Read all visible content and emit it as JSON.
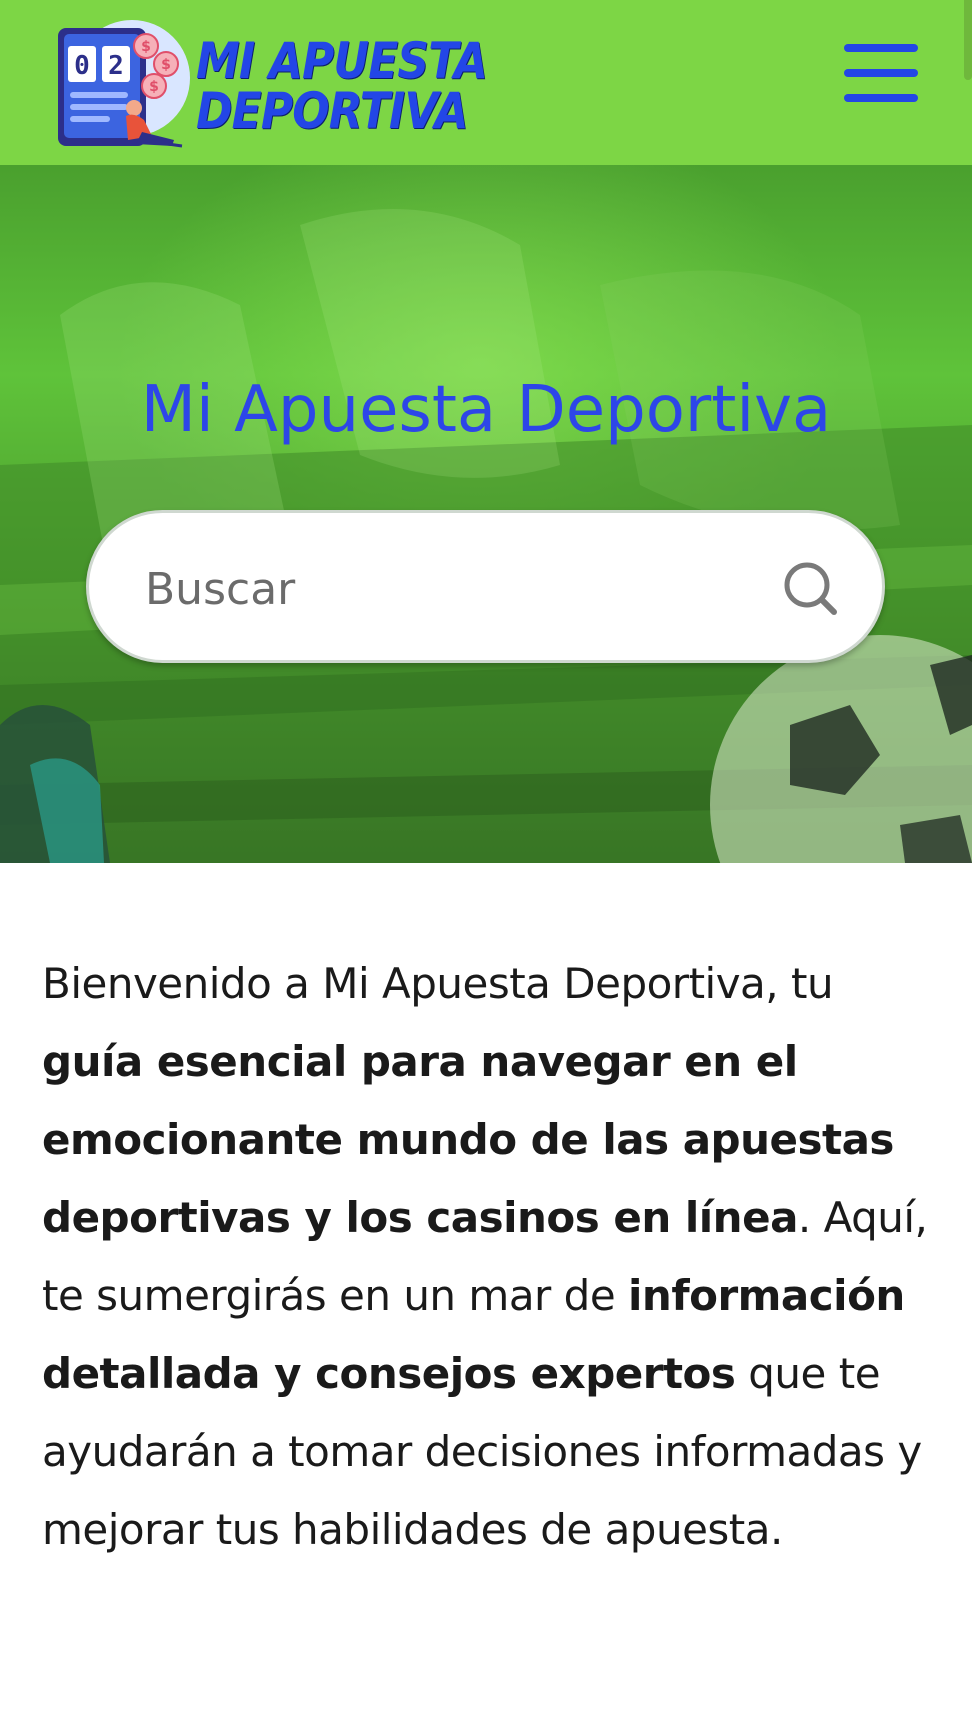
{
  "header": {
    "logo_line1": "MI APUESTA",
    "logo_line2": "DEPORTIVA",
    "logo_score": "02",
    "menu_icon": "hamburger-menu-icon",
    "bg_color": "#7dd645",
    "accent": "#2346e6"
  },
  "hero": {
    "title": "Mi Apuesta Deportiva",
    "title_color": "#2d46e8"
  },
  "search": {
    "placeholder": "Buscar",
    "value": "",
    "icon": "search-icon"
  },
  "intro": {
    "p1": "Bienvenido a Mi Apuesta Deportiva, tu ",
    "b1": "guía esencial para navegar en el emocionante mundo de las apuestas deportivas y los casinos en línea",
    "p2": ". Aquí, te sumergirás en un mar de ",
    "b2": "información detallada y consejos expertos",
    "p3": " que te ayudarán a tomar decisiones informadas y mejorar tus habilidades de apuesta."
  }
}
